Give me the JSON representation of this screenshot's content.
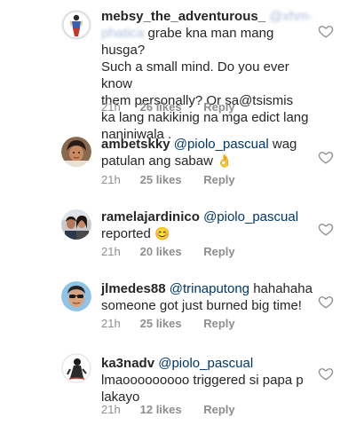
{
  "comments": [
    {
      "username": "mebsy_the_adventurous_",
      "blur_a": "@xhm-",
      "blur_b": "phatica",
      "text_1": "grabe kna man mang husga?",
      "text_2": "Such a small mind. Do you ever know",
      "text_3": "them personally? Or sa@tsismis",
      "text_4": "ka lang nakikinig na mga edict lang",
      "text_5": "naniniwala .",
      "time": "21h",
      "likes": "26 likes",
      "reply": "Reply",
      "avatar_icon": "avatar-superhero-icon"
    },
    {
      "username": "ambetskky",
      "mention": "@piolo_pascual",
      "text_1": "wag",
      "text_2": "patulan ang sabaw",
      "emoji": "👌",
      "time": "21h",
      "likes": "25 likes",
      "reply": "Reply",
      "avatar_icon": "avatar-woman-icon"
    },
    {
      "username": "ramelajardinico",
      "mention": "@piolo_pascual",
      "text_2": "reported",
      "emoji": "😊",
      "time": "21h",
      "likes": "20 likes",
      "reply": "Reply",
      "avatar_icon": "avatar-couple-icon"
    },
    {
      "username": "jlmedes88",
      "mention": "@trinaputong",
      "text_1": "hahahaha",
      "text_2": "someone got just burned big time!",
      "time": "21h",
      "likes": "25 likes",
      "reply": "Reply",
      "avatar_icon": "avatar-man-sunglasses-icon"
    },
    {
      "username": "ka3nadv",
      "mention": "@piolo_pascual",
      "text_2": "lmaooooooooo triggered si papa p",
      "text_3": "lakayo",
      "time": "21h",
      "likes": "12 likes",
      "reply": "Reply",
      "avatar_icon": "avatar-sketch-icon"
    }
  ],
  "colors": {
    "text": "#262626",
    "mention": "#00376b",
    "meta": "#8e8e8e",
    "heart_outline": "#8e8e8e"
  }
}
